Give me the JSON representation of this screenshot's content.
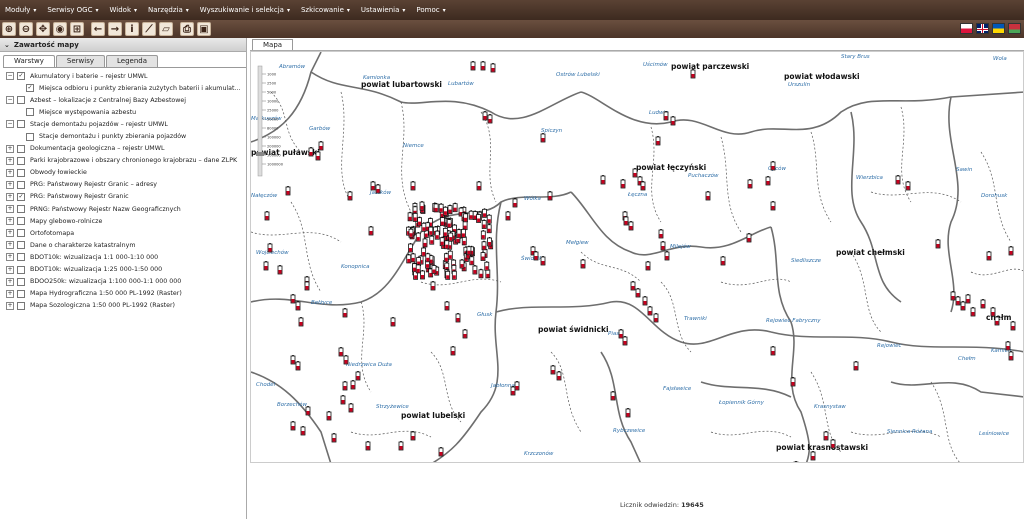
{
  "menu": [
    {
      "label": "Moduły"
    },
    {
      "label": "Serwisy OGC"
    },
    {
      "label": "Widok"
    },
    {
      "label": "Narzędzia"
    },
    {
      "label": "Wyszukiwanie i selekcja"
    },
    {
      "label": "Szkicowanie"
    },
    {
      "label": "Ustawienia"
    },
    {
      "label": "Pomoc"
    }
  ],
  "toolbar_icons": [
    "zoom-in-icon",
    "zoom-out-icon",
    "pan-icon",
    "full-extent-icon",
    "zoom-box-icon",
    "back-icon",
    "forward-icon",
    "info-icon",
    "measure-line-icon",
    "measure-area-icon",
    "print-icon",
    "save-icon"
  ],
  "panel": {
    "title": "Zawartość mapy",
    "tabs": [
      "Warstwy",
      "Serwisy",
      "Legenda"
    ],
    "layers": [
      {
        "label": "Akumulatory i baterie – rejestr UMWL",
        "checked": true,
        "expanded": true,
        "indent": 0
      },
      {
        "label": "Miejsca odbioru i punkty zbierania zużytych baterii i akumulat...",
        "checked": true,
        "indent": 1
      },
      {
        "label": "Azbest – lokalizacje z Centralnej Bazy Azbestowej",
        "checked": false,
        "expanded": true,
        "indent": 0
      },
      {
        "label": "Miejsce występowania azbestu",
        "checked": false,
        "indent": 1
      },
      {
        "label": "Stacje demontażu pojazdów – rejestr UMWL",
        "checked": false,
        "expanded": true,
        "indent": 0
      },
      {
        "label": "Stacje demontażu i punkty zbierania pojazdów",
        "checked": false,
        "indent": 1
      },
      {
        "label": "Dokumentacja geologiczna – rejestr UMWL",
        "checked": false,
        "indent": 0
      },
      {
        "label": "Parki krajobrazowe i obszary chronionego krajobrazu – dane ZLPK",
        "checked": false,
        "indent": 0
      },
      {
        "label": "Obwody łowieckie",
        "checked": false,
        "indent": 0
      },
      {
        "label": "PRG: Państwowy Rejestr Granic – adresy",
        "checked": false,
        "indent": 0
      },
      {
        "label": "PRG: Państwowy Rejestr Granic",
        "checked": true,
        "indent": 0
      },
      {
        "label": "PRNG: Państwowy Rejestr Nazw Geograficznych",
        "checked": false,
        "indent": 0
      },
      {
        "label": "Mapy glebowo-rolnicze",
        "checked": false,
        "indent": 0
      },
      {
        "label": "Ortofotomapa",
        "checked": false,
        "indent": 0
      },
      {
        "label": "Dane o charakterze katastralnym",
        "checked": false,
        "indent": 0
      },
      {
        "label": "BDOT10k: wizualizacja 1:1 000-1:10 000",
        "checked": false,
        "indent": 0
      },
      {
        "label": "BDOT10k: wizualizacja 1:25 000-1:50 000",
        "checked": false,
        "indent": 0
      },
      {
        "label": "BDOO250k: wizualizacja 1:100 000-1:1 000 000",
        "checked": false,
        "indent": 0
      },
      {
        "label": "Mapa Hydrograficzna 1:50 000 PL-1992 (Raster)",
        "checked": false,
        "indent": 0
      },
      {
        "label": "Mapa Sozologiczna 1:50 000 PL-1992 (Raster)",
        "checked": false,
        "indent": 0
      }
    ]
  },
  "map_tab": "Mapa",
  "zoom_scales": [
    "1000",
    "2500",
    "5000",
    "10000",
    "25000",
    "50000",
    "80000",
    "100000",
    "200000",
    "500000",
    "1000000"
  ],
  "counties": [
    {
      "name": "powiat parczewski"
    },
    {
      "name": "powiat lubartowski"
    },
    {
      "name": "powiat włodawski"
    },
    {
      "name": "powiat puławski"
    },
    {
      "name": "powiat łęczyński"
    },
    {
      "name": "powiat chełmski"
    },
    {
      "name": "powiat świdnicki"
    },
    {
      "name": "powiat lubelski"
    },
    {
      "name": "powiat krasnostawski"
    },
    {
      "name": "chełm"
    }
  ],
  "places": [
    {
      "name": "Abramów"
    },
    {
      "name": "Kamionka"
    },
    {
      "name": "Lubartów"
    },
    {
      "name": "Ostrów Lubelski"
    },
    {
      "name": "Uścimów"
    },
    {
      "name": "Stary Brus"
    },
    {
      "name": "Wola"
    },
    {
      "name": "Urszulin"
    },
    {
      "name": "Markuszów"
    },
    {
      "name": "Garbów"
    },
    {
      "name": "Niemce"
    },
    {
      "name": "Spiczyn"
    },
    {
      "name": "Ludwin"
    },
    {
      "name": "Cyców"
    },
    {
      "name": "Puchaczów"
    },
    {
      "name": "Wierzbica"
    },
    {
      "name": "Sawin"
    },
    {
      "name": "Nałęczów"
    },
    {
      "name": "Jastków"
    },
    {
      "name": "Wólka"
    },
    {
      "name": "Łęczna"
    },
    {
      "name": "Dorohusk"
    },
    {
      "name": "Wojciechów"
    },
    {
      "name": "Konopnica"
    },
    {
      "name": "Mełgiew"
    },
    {
      "name": "Milejów"
    },
    {
      "name": "Siedliszcze"
    },
    {
      "name": "Świdnik"
    },
    {
      "name": "Bełżyce"
    },
    {
      "name": "Głusk"
    },
    {
      "name": "Trawniki"
    },
    {
      "name": "Rejowiec Fabryczny"
    },
    {
      "name": "Rejowiec"
    },
    {
      "name": "Piaski"
    },
    {
      "name": "Niedrzwica Duża"
    },
    {
      "name": "Chodel"
    },
    {
      "name": "Jabłonna"
    },
    {
      "name": "Fajsławice"
    },
    {
      "name": "Chełm"
    },
    {
      "name": "Kamień"
    },
    {
      "name": "Borzechów"
    },
    {
      "name": "Strzyżewice"
    },
    {
      "name": "Łopiennik Górny"
    },
    {
      "name": "Krasnystaw"
    },
    {
      "name": "Rybczewice"
    },
    {
      "name": "Krzczonów"
    },
    {
      "name": "Siennica Różana"
    },
    {
      "name": "Leśniowice"
    }
  ],
  "footer": {
    "label": "Licznik odwiedzin:",
    "count": "19645"
  },
  "colors": {
    "menubar": "#4a3327",
    "marker_red": "#c8001e",
    "border": "#6b6b6b"
  }
}
